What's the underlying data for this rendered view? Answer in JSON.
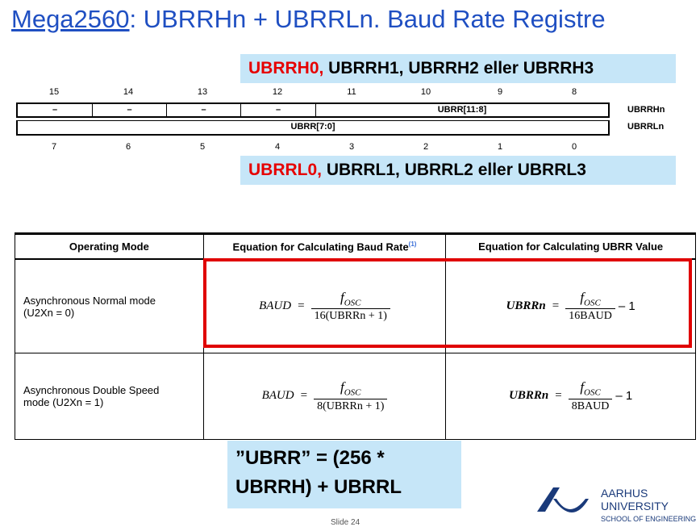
{
  "title": {
    "prefix": "Mega2560",
    "rest": ": UBRRHn + UBRRLn. Baud Rate Registre"
  },
  "callout_high": {
    "red": "UBRRH0,",
    "rest": " UBRRH1, UBRRH2 eller UBRRH3"
  },
  "callout_low": {
    "red": "UBRRL0,",
    "rest": " UBRRL1, UBRRL2 eller UBRRL3"
  },
  "register": {
    "bits_top": [
      "15",
      "14",
      "13",
      "12",
      "11",
      "10",
      "9",
      "8"
    ],
    "bits_bottom": [
      "7",
      "6",
      "5",
      "4",
      "3",
      "2",
      "1",
      "0"
    ],
    "high_cells": [
      "–",
      "–",
      "–",
      "–",
      "UBRR[11:8]"
    ],
    "low_cell": "UBRR[7:0]",
    "high_name": "UBRRHn",
    "low_name": "UBRRLn"
  },
  "table": {
    "headers": [
      "Operating Mode",
      "Equation for Calculating Baud Rate",
      "Equation for Calculating UBRR Value"
    ],
    "header_ref": "(1)",
    "rows": [
      {
        "mode_line1": "Asynchronous Normal mode",
        "mode_line2": "(U2Xn = 0)",
        "baud_lhs": "BAUD",
        "baud_num": "f",
        "baud_num_sub": "OSC",
        "baud_den": "16(UBRRn + 1)",
        "ubrr_lhs": "UBRRn",
        "ubrr_num": "f",
        "ubrr_num_sub": "OSC",
        "ubrr_den": "16BAUD",
        "ubrr_tail": "– 1"
      },
      {
        "mode_line1": "Asynchronous Double Speed",
        "mode_line2": "mode (U2Xn = 1)",
        "baud_lhs": "BAUD",
        "baud_num": "f",
        "baud_num_sub": "OSC",
        "baud_den": "8(UBRRn + 1)",
        "ubrr_lhs": "UBRRn",
        "ubrr_num": "f",
        "ubrr_num_sub": "OSC",
        "ubrr_den": "8BAUD",
        "ubrr_tail": "– 1"
      }
    ]
  },
  "note": {
    "line1": "”UBRR” = (256 *",
    "line2": "UBRRH) + UBRRL"
  },
  "logo": {
    "line1": "AARHUS",
    "line2": "UNIVERSITY",
    "line3": "SCHOOL OF ENGINEERING"
  },
  "slide_number": "Slide 24",
  "colors": {
    "title": "#1f4fc2",
    "callout_bg": "#c6e6f8",
    "highlight": "#e00000"
  }
}
